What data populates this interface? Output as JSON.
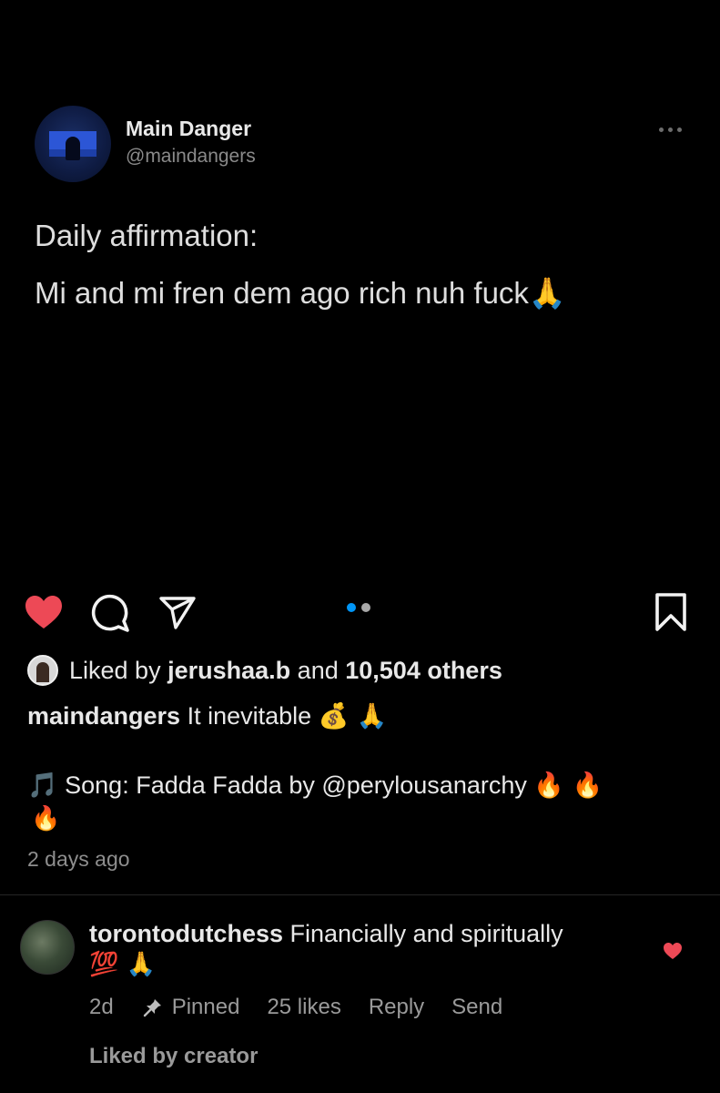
{
  "tweet": {
    "display_name": "Main Danger",
    "handle": "@maindangers",
    "line1": "Daily affirmation:",
    "line2": "Mi and mi fren dem ago rich nuh fuck",
    "line2_emoji": "🙏"
  },
  "icons": {
    "like": "heart-icon",
    "comment": "comment-icon",
    "share": "send-icon",
    "save": "bookmark-icon",
    "more": "more-icon"
  },
  "carousel": {
    "count": 2,
    "active_index": 0
  },
  "likes": {
    "prefix": "Liked by",
    "user": "jerushaa.b",
    "middle": "and",
    "others": "10,504 others"
  },
  "caption": {
    "username": "maindangers",
    "text": "It inevitable",
    "emojis": "💰 🙏"
  },
  "song": {
    "note": "🎵",
    "text": "Song: Fadda Fadda by @perylousanarchy",
    "emojis_inline": "🔥 🔥",
    "emoji_wrap": "🔥"
  },
  "post_time": "2 days ago",
  "comment": {
    "username": "torontodutchess",
    "text": "Financially and spiritually",
    "emojis": "💯 🙏",
    "time": "2d",
    "pinned": "Pinned",
    "likes": "25 likes",
    "reply": "Reply",
    "send": "Send",
    "liked_by_creator": "Liked by creator"
  },
  "colors": {
    "background": "#000000",
    "like_red": "#ed4956",
    "carousel_active": "#0095f6",
    "carousel_inactive": "#a8a8a8",
    "muted_text": "#8e8e8e"
  }
}
